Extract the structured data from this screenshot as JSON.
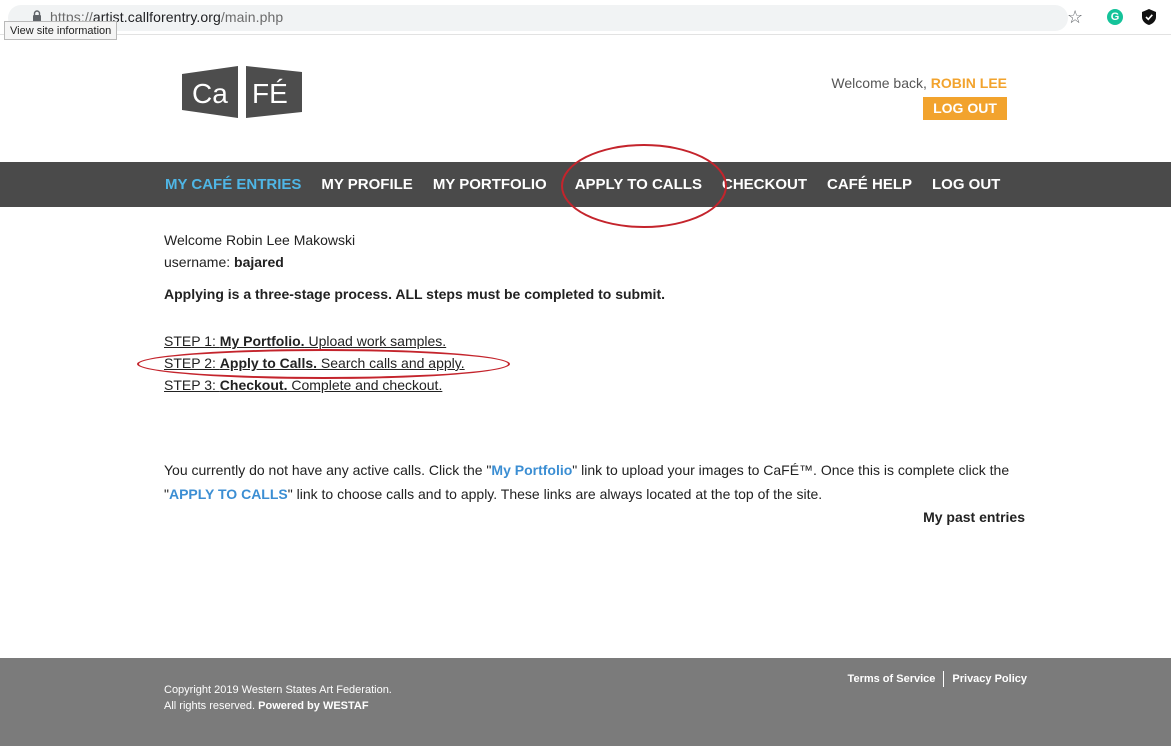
{
  "browser": {
    "url_scheme": "https://",
    "url_host": "artist.callforentry.org",
    "url_path": "/main.php",
    "tooltip": "View site information",
    "grammarly_letter": "G"
  },
  "header": {
    "logo_text": "CaFÉ",
    "welcome_prefix": "Welcome back, ",
    "user_name": "ROBIN LEE",
    "logout_label": "LOG OUT"
  },
  "nav": {
    "items": [
      {
        "label": "MY CAFÉ ENTRIES",
        "active": true
      },
      {
        "label": "MY PROFILE"
      },
      {
        "label": "MY PORTFOLIO"
      },
      {
        "label": "APPLY TO CALLS"
      },
      {
        "label": "CHECKOUT"
      },
      {
        "label": "CAFÉ HELP"
      },
      {
        "label": "LOG OUT"
      }
    ]
  },
  "main": {
    "welcome": "Welcome Robin Lee Makowski",
    "username_label": "username: ",
    "username_value": "bajared",
    "process_note": "Applying is a three-stage process. ALL steps must be completed to submit.",
    "steps": [
      {
        "prefix": "STEP 1: ",
        "title": "My Portfolio.",
        "desc": " Upload work samples."
      },
      {
        "prefix": "STEP 2: ",
        "title": "Apply to Calls.",
        "desc": " Search calls and apply."
      },
      {
        "prefix": "STEP 3: ",
        "title": "Checkout.",
        "desc": " Complete and checkout."
      }
    ],
    "info_1": "You currently do not have any active calls. Click the \"",
    "info_link_portfolio": "My Portfolio",
    "info_2": "\" link to upload your images to CaFÉ™. Once this is complete click the \"",
    "info_link_calls": "APPLY TO CALLS",
    "info_3": "\" link to choose calls and to apply. These links are always located at the top of the site.",
    "past_entries": "My past entries"
  },
  "footer": {
    "copyright_line1": "Copyright 2019 Western States Art Federation.",
    "copyright_line2_prefix": "All rights reserved. ",
    "copyright_line2_strong": "Powered by WESTAF",
    "terms_label": "Terms of Service",
    "privacy_label": "Privacy Policy"
  },
  "colors": {
    "accent_orange": "#f2a32d",
    "nav_bg": "#4a4a4a",
    "nav_active": "#4fb6e6",
    "link_blue": "#3b8ed3",
    "footer_bg": "#7b7b7b",
    "annotation_red": "#c4242c"
  }
}
